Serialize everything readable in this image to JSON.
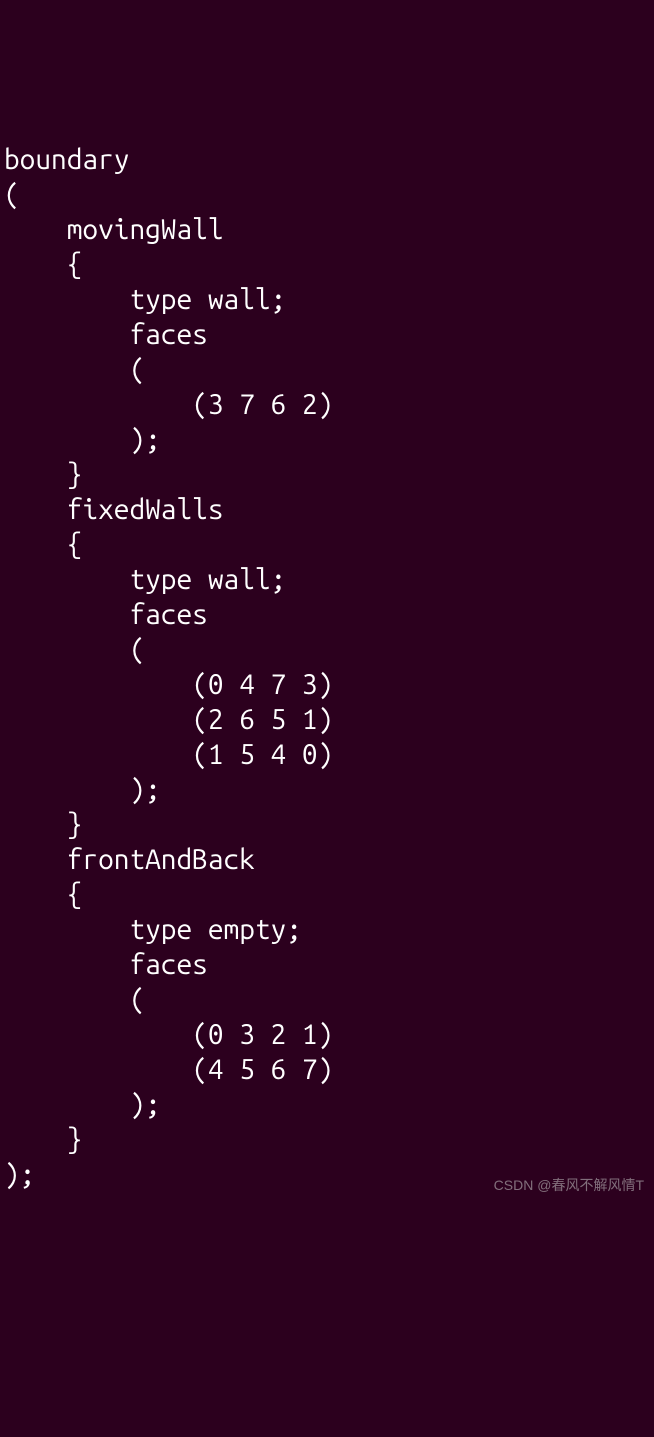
{
  "code": {
    "line1": "boundary",
    "line2": "(",
    "line3": "    movingWall",
    "line4": "    {",
    "line5": "        type wall;",
    "line6": "        faces",
    "line7": "        (",
    "line8": "            (3 7 6 2)",
    "line9": "        );",
    "line10": "    }",
    "line11": "    fixedWalls",
    "line12": "    {",
    "line13": "        type wall;",
    "line14": "        faces",
    "line15": "        (",
    "line16": "            (0 4 7 3)",
    "line17": "            (2 6 5 1)",
    "line18": "            (1 5 4 0)",
    "line19": "        );",
    "line20": "    }",
    "line21": "    frontAndBack",
    "line22": "    {",
    "line23": "        type empty;",
    "line24": "        faces",
    "line25": "        (",
    "line26": "            (0 3 2 1)",
    "line27": "            (4 5 6 7)",
    "line28": "        );",
    "line29": "    }",
    "line30": ");"
  },
  "watermark": "CSDN @春风不解风情T"
}
